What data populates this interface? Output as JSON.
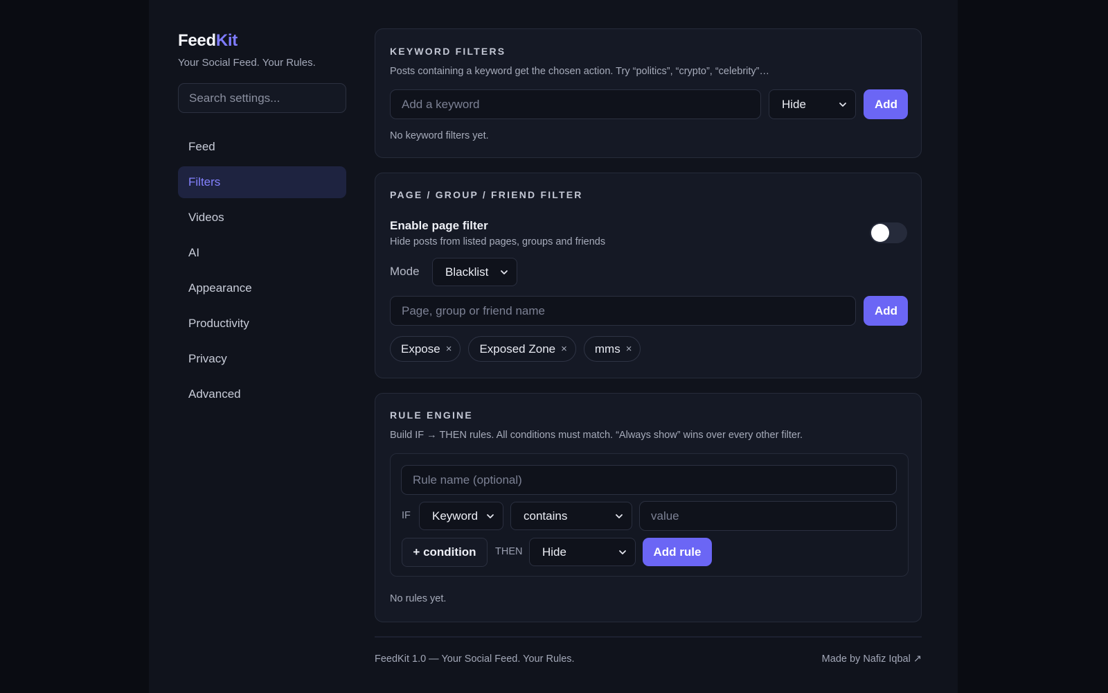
{
  "brand": {
    "name_main": "Feed",
    "name_accent": "Kit",
    "tagline": "Your Social Feed. Your Rules."
  },
  "search": {
    "placeholder": "Search settings..."
  },
  "nav": {
    "items": [
      {
        "label": "Feed"
      },
      {
        "label": "Filters",
        "active": true
      },
      {
        "label": "Videos"
      },
      {
        "label": "AI"
      },
      {
        "label": "Appearance"
      },
      {
        "label": "Productivity"
      },
      {
        "label": "Privacy"
      },
      {
        "label": "Advanced"
      }
    ]
  },
  "keyword_filters": {
    "title": "KEYWORD FILTERS",
    "description": "Posts containing a keyword get the chosen action. Try “politics”, “crypto”, “celebrity”…",
    "input_placeholder": "Add a keyword",
    "action_selected": "Hide",
    "add_label": "Add",
    "empty_text": "No keyword filters yet."
  },
  "page_filter": {
    "title": "PAGE / GROUP / FRIEND FILTER",
    "toggle_label": "Enable page filter",
    "toggle_description": "Hide posts from listed pages, groups and friends",
    "toggle_on": false,
    "mode_label": "Mode",
    "mode_selected": "Blacklist",
    "input_placeholder": "Page, group or friend name",
    "add_label": "Add",
    "chips": [
      "Expose",
      "Exposed Zone",
      "mms"
    ],
    "chip_remove_glyph": "×"
  },
  "rule_engine": {
    "title": "RULE ENGINE",
    "description": "Build IF → THEN rules. All conditions must match. “Always show” wins over every other filter.",
    "rule_name_placeholder": "Rule name (optional)",
    "if_label": "IF",
    "field_selected": "Keyword",
    "operator_selected": "contains",
    "value_placeholder": "value",
    "add_condition_label": "+ condition",
    "then_label": "THEN",
    "action_selected": "Hide",
    "add_rule_label": "Add rule",
    "empty_text": "No rules yet."
  },
  "footer": {
    "left": "FeedKit 1.0 — Your Social Feed. Your Rules.",
    "right": "Made by Nafiz Iqbal ↗"
  },
  "colors": {
    "accent": "#6b66f5",
    "accent_text": "#7f7cff",
    "background": "#10131c",
    "card": "#151925"
  }
}
